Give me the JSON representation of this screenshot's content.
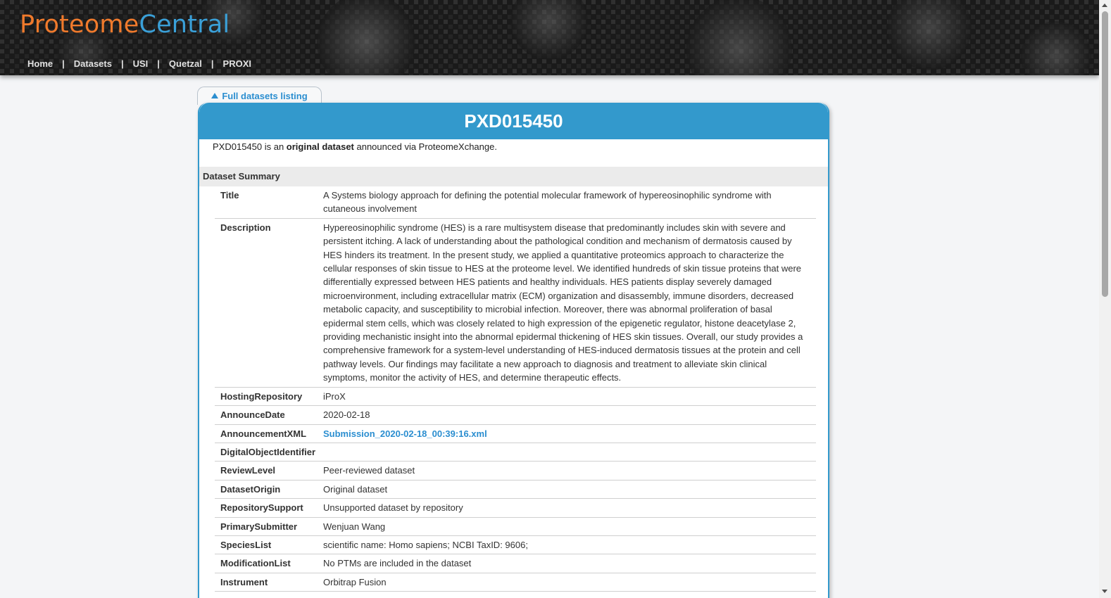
{
  "header": {
    "logo_part1": "Proteome",
    "logo_part2": "Central",
    "nav": [
      "Home",
      "Datasets",
      "USI",
      "Quetzal",
      "PROXI"
    ],
    "nav_separator": "|"
  },
  "back_link": {
    "label": "Full datasets listing"
  },
  "dataset": {
    "id": "PXD015450",
    "intro_prefix": "PXD015450 is an ",
    "intro_bold": "original dataset",
    "intro_suffix": " announced via ProteomeXchange."
  },
  "summary": {
    "section_label": "Dataset Summary",
    "rows": [
      {
        "key": "Title",
        "value": "A Systems biology approach for defining the potential molecular framework of hypereosinophilic syndrome with cutaneous involvement"
      },
      {
        "key": "Description",
        "value": "Hypereosinophilic syndrome (HES) is a rare multisystem disease that predominantly includes skin with severe and persistent itching. A lack of understanding about the pathological condition and mechanism of dermatosis caused by HES hinders its treatment. In the present study, we applied a quantitative proteomics approach to characterize the cellular responses of skin tissue to HES at the proteome level. We identified hundreds of skin tissue proteins that were differentially expressed between HES patients and healthy individuals. HES patients display severely damaged microenvironment, including extracellular matrix (ECM) organization and disassembly, immune disorders, decreased metabolic capacity, and susceptibility to microbial infection. Moreover, there was abnormal proliferation of basal epidermal stem cells, which was closely related to high expression of the epigenetic regulator, histone deacetylase 2, providing mechanistic insight into the abnormal epidermal thickening of HES skin tissues. Overall, our study provides a comprehensive framework for a system-level understanding of HES-induced dermatosis tissues at the protein and cell pathway levels. Our findings may facilitate a new approach to diagnosis and treatment to alleviate skin clinical symptoms, monitor the activity of HES, and determine therapeutic effects."
      },
      {
        "key": "HostingRepository",
        "value": "iProX"
      },
      {
        "key": "AnnounceDate",
        "value": "2020-02-18"
      },
      {
        "key": "AnnouncementXML",
        "value": "Submission_2020-02-18_00:39:16.xml",
        "link": true
      },
      {
        "key": "DigitalObjectIdentifier",
        "value": ""
      },
      {
        "key": "ReviewLevel",
        "value": "Peer-reviewed dataset"
      },
      {
        "key": "DatasetOrigin",
        "value": "Original dataset"
      },
      {
        "key": "RepositorySupport",
        "value": "Unsupported dataset by repository"
      },
      {
        "key": "PrimarySubmitter",
        "value": "Wenjuan Wang"
      },
      {
        "key": "SpeciesList",
        "value": "scientific name: Homo sapiens; NCBI TaxID: 9606;"
      },
      {
        "key": "ModificationList",
        "value": "No PTMs are included in the dataset"
      },
      {
        "key": "Instrument",
        "value": "Orbitrap Fusion"
      }
    ]
  },
  "colors": {
    "accent": "#3399cc",
    "link": "#2b8ed0",
    "logo_orange": "#f07a2c",
    "logo_blue": "#3aa0d8"
  }
}
